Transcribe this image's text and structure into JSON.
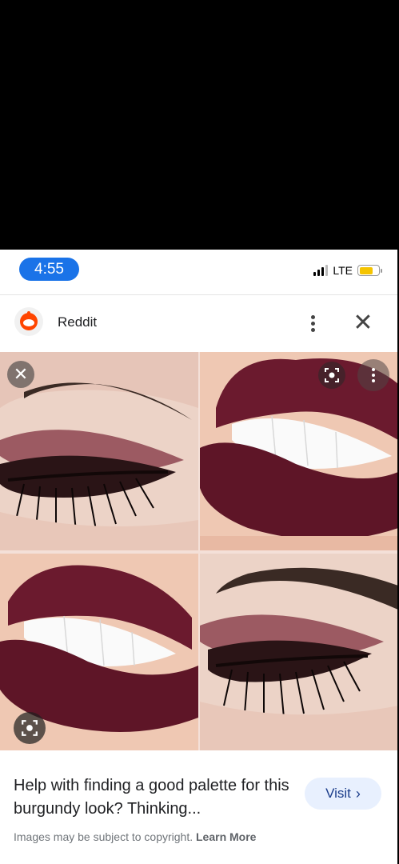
{
  "status_bar": {
    "time": "4:55",
    "network": "LTE",
    "battery_level": 0.7,
    "battery_color": "#f5c400",
    "time_pill_color": "#1a73e8"
  },
  "source": {
    "name": "Reddit",
    "logo_icon": "reddit-logo-icon"
  },
  "header_actions": {
    "more_icon": "more-vert-icon",
    "close_icon": "close-icon"
  },
  "image_overlay": {
    "close_icon": "close-icon",
    "lens_icon": "lens-icon",
    "more_icon": "more-vert-icon"
  },
  "result": {
    "caption": "Help with finding a good palette for this burgundy look? Thinking...",
    "visit_label": "Visit",
    "copyright_text": "Images may be subject to copyright.",
    "learn_more_label": "Learn More"
  },
  "colors": {
    "burgundy": "#6b1a2e",
    "accent_blue": "#1a73e8"
  }
}
